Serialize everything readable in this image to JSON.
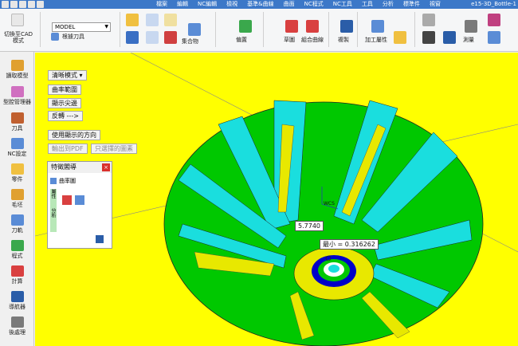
{
  "window": {
    "title": "e15-3D_Bottle-1"
  },
  "menu": [
    "檔案",
    "編輯",
    "NC編輯",
    "檢視",
    "基準&曲線",
    "曲面",
    "NC程式",
    "NC工具",
    "工具",
    "分析",
    "標準件",
    "視窗"
  ],
  "ribbon": {
    "cad_switch": "切換至CAD模式",
    "model_select": "MODEL",
    "tool_label": "根據刀具",
    "group_merge": "集合物",
    "flat": "偏置",
    "sketch": "草圖",
    "combine_curves": "組合曲線",
    "copy": "複製",
    "machining_attr": "加工屬性",
    "measure": "測量"
  },
  "leftbar": [
    "讀取模型",
    "型腔管理器",
    "刀具",
    "NC設定",
    "零件",
    "毛坯",
    "刀軌",
    "程式",
    "計算",
    "導航器",
    "後處理"
  ],
  "view_buttons": {
    "clear_mode": "清晰模式 ▾",
    "curvature_range": "曲率範圍",
    "show_sharp": "顯示尖邊",
    "reverse": "反轉 --->",
    "use_show_dir": "使用顯示的方向",
    "export_pdf": "輸出到PDF",
    "only_selected": "只選擇的圖素"
  },
  "panel": {
    "title": "特徵閣導",
    "item": "曲率圖",
    "tab_a": "屬性",
    "tab_b": "分析",
    "close": "×"
  },
  "labels": {
    "value": "5.7740",
    "min": "最小 = 0.316262",
    "mouse": "WCS"
  }
}
